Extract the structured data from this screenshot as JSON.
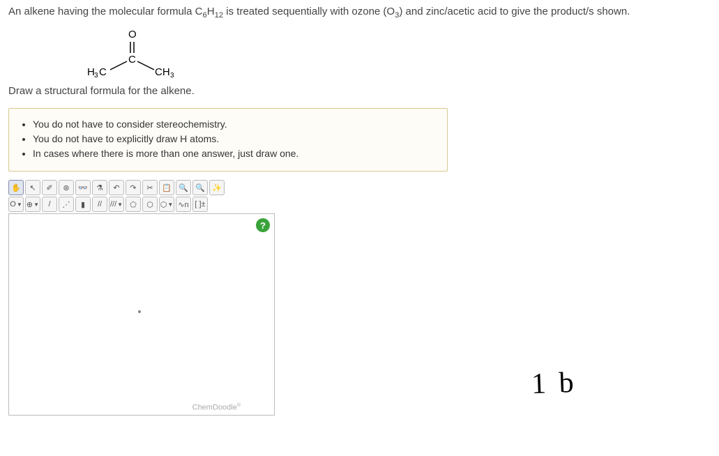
{
  "question": {
    "prompt_pre": "An alkene having the molecular formula ",
    "formula_c": "C",
    "formula_c_sub": "6",
    "formula_h": "H",
    "formula_h_sub": "12",
    "prompt_post": " is treated sequentially with ozone (O",
    "ozone_sub": "3",
    "prompt_end": ") and zinc/acetic acid to give the product/s shown."
  },
  "molecule": {
    "top": "O",
    "center": "C",
    "left": "H",
    "left_sub": "3",
    "left_c": "C",
    "right": "CH",
    "right_sub": "3"
  },
  "sub_prompt": "Draw a structural formula for the alkene.",
  "hints": [
    "You do not have to consider stereochemistry.",
    "You do not have to explicitly draw H atoms.",
    "In cases where there is more than one answer, just draw one."
  ],
  "toolbar1": {
    "hand": "✋",
    "arrow": "↖",
    "lasso": "◯",
    "eraser": "✐",
    "center": "⊛",
    "goggles": "👓",
    "flask": "⚗",
    "undo": "↶",
    "redo": "↷",
    "cut": "✂",
    "paste": "📋",
    "zoomin": "🔍+",
    "zoomout": "🔍-",
    "clean": "✨"
  },
  "toolbar2": {
    "atom": "O",
    "plus": "⊕",
    "bond1": "/",
    "bond_dotted": "⋰",
    "bond_wedge": "▮",
    "bond2": "//",
    "bond3": "///",
    "ring_penta": "⬠",
    "ring_hexa": "⬡",
    "ring_benz": "⬡",
    "chain": "∿n",
    "brackets": "[ ]±"
  },
  "canvas": {
    "help": "?",
    "brand": "ChemDoodle",
    "brand_sup": "®"
  },
  "handwritten_note": "1 b"
}
